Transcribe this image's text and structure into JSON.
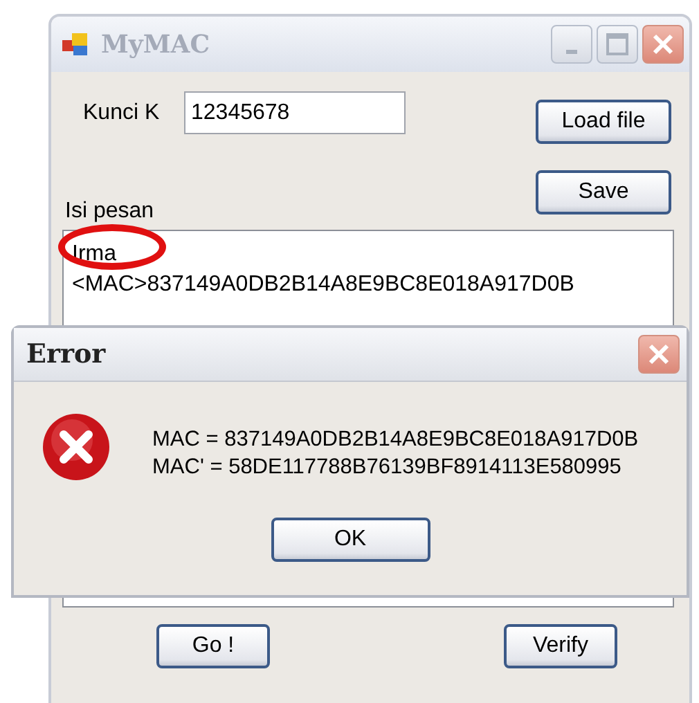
{
  "main_window": {
    "title": "MyMAC",
    "key_label": "Kunci K",
    "key_value": "12345678",
    "side_buttons": [
      "Load file",
      "Save"
    ],
    "message_label": "Isi pesan",
    "message_lines": [
      "Irma",
      "<MAC>837149A0DB2B14A8E9BC8E018A917D0B"
    ],
    "bottom_buttons": [
      "Go !",
      "Verify"
    ]
  },
  "error_dialog": {
    "title": "Error",
    "lines": [
      "MAC = 837149A0DB2B14A8E9BC8E018A917D0B",
      "MAC' = 58DE117788B76139BF8914113E580995"
    ],
    "button": "OK"
  }
}
